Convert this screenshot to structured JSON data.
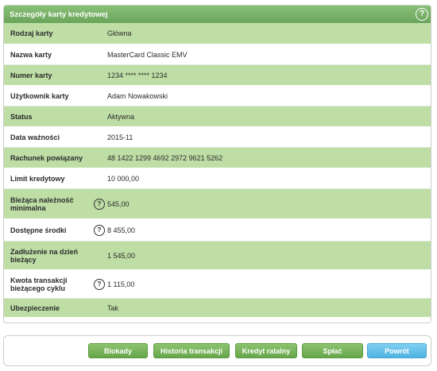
{
  "panel": {
    "title": "Szczegóły karty kredytowej",
    "help_icon_glyph": "?"
  },
  "rows": [
    {
      "label": "Rodzaj karty",
      "value": "Główna",
      "help": false
    },
    {
      "label": "Nazwa karty",
      "value": "MasterCard Classic EMV",
      "help": false
    },
    {
      "label": "Numer karty",
      "value": "1234 **** **** 1234",
      "help": false
    },
    {
      "label": "Użytkownik karty",
      "value": "Adam Nowakowski",
      "help": false
    },
    {
      "label": "Status",
      "value": "Aktywna",
      "help": false
    },
    {
      "label": "Data ważności",
      "value": "2015-11",
      "help": false
    },
    {
      "label": "Rachunek powiązany",
      "value": "48 1422 1299 4692 2972 9621 5262",
      "help": false
    },
    {
      "label": "Limit kredytowy",
      "value": "10 000,00",
      "help": false
    },
    {
      "label": "Bieżąca należność minimalna",
      "value": "545,00",
      "help": true
    },
    {
      "label": "Dostępne środki",
      "value": "8 455,00",
      "help": true
    },
    {
      "label": "Zadłużenie na dzień bieżący",
      "value": "1 545,00",
      "help": false
    },
    {
      "label": "Kwota transakcji bieżącego cyklu",
      "value": "1 115,00",
      "help": true
    },
    {
      "label": "Ubezpieczenie",
      "value": "Tak",
      "help": false
    }
  ],
  "buttons": {
    "blokady": "Blokady",
    "historia": "Historia transakcji",
    "kredyt": "Kredyt ratalny",
    "splac": "Spłać",
    "powrot": "Powrót"
  },
  "colors": {
    "header": "#78b267",
    "row_green": "#bedea6",
    "button_green": "#72ad54",
    "button_blue": "#5dbde8"
  }
}
